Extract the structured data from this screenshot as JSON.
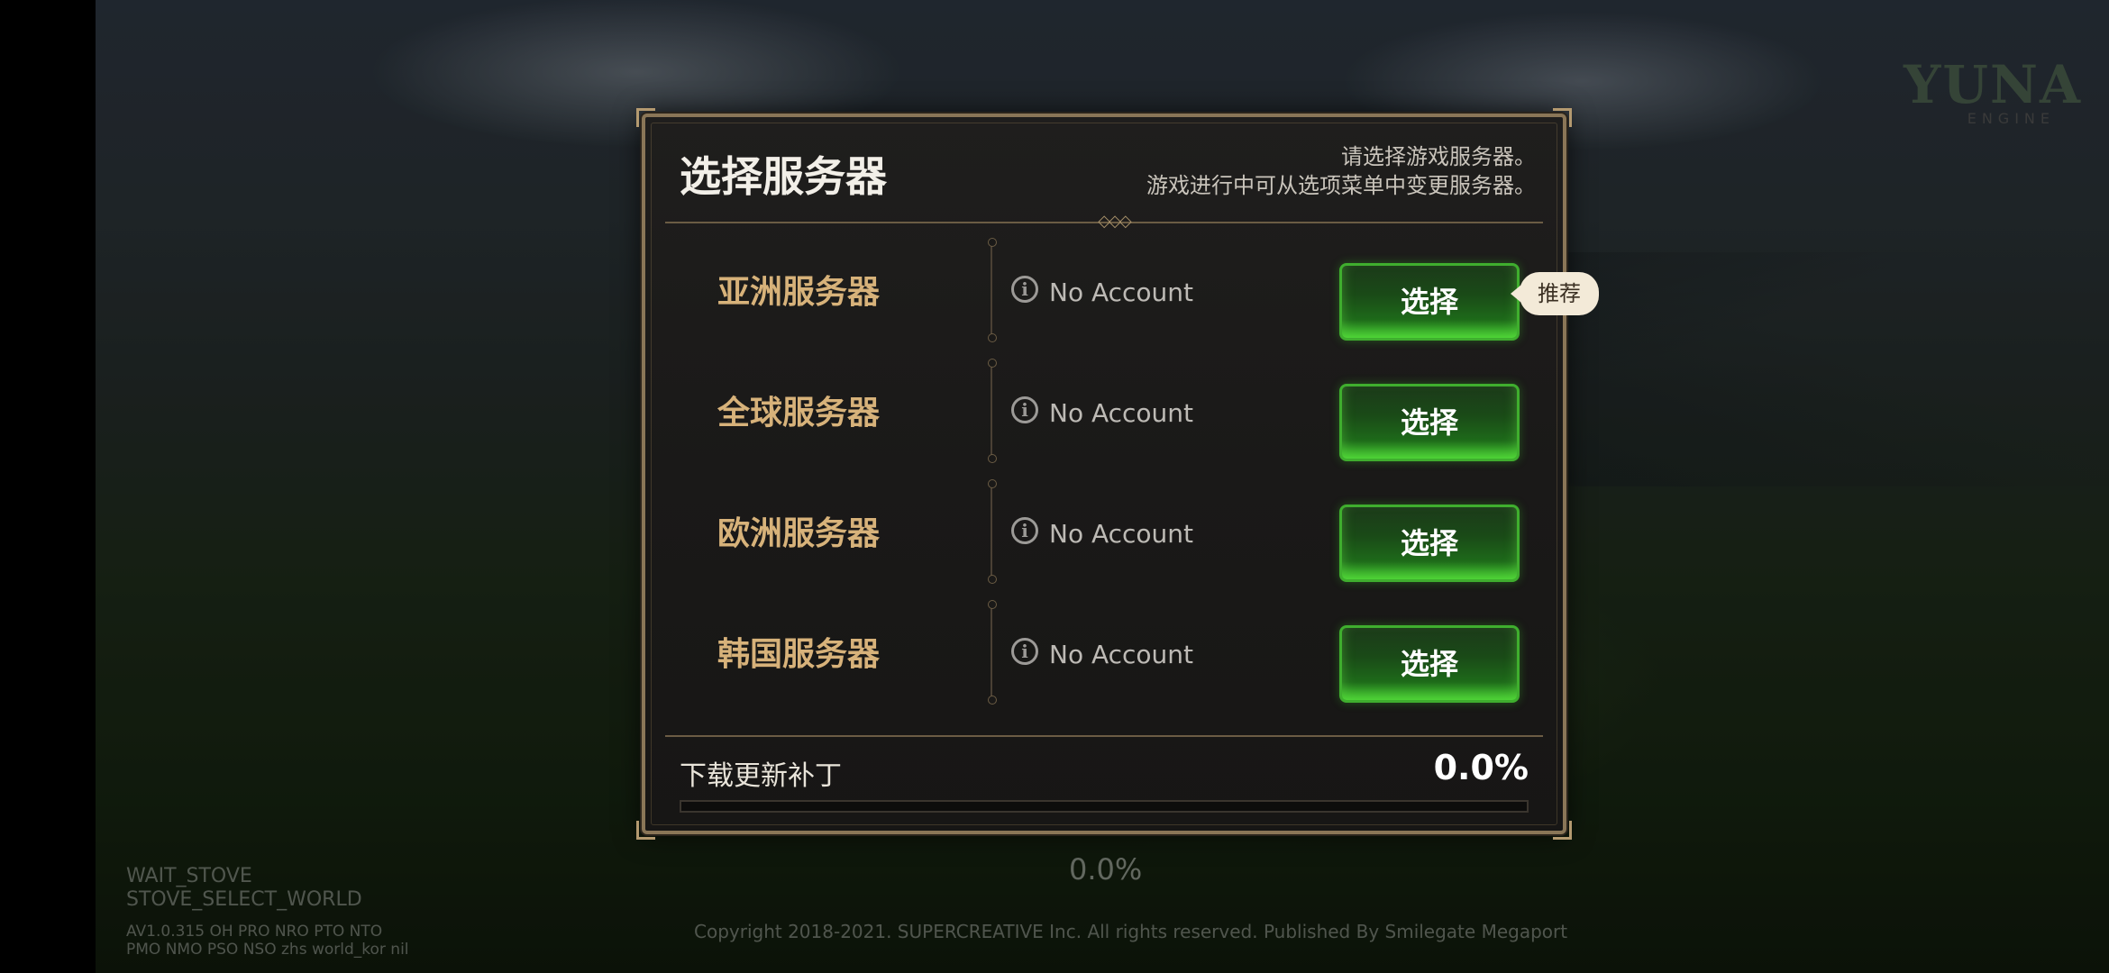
{
  "panel": {
    "title": "选择服务器",
    "hint_line1": "请选择游戏服务器。",
    "hint_line2": "游戏进行中可从选项菜单中变更服务器。"
  },
  "servers": [
    {
      "name": "亚洲服务器",
      "account": "No Account",
      "button": "选择"
    },
    {
      "name": "全球服务器",
      "account": "No Account",
      "button": "选择"
    },
    {
      "name": "欧洲服务器",
      "account": "No Account",
      "button": "选择"
    },
    {
      "name": "韩国服务器",
      "account": "No Account",
      "button": "选择"
    }
  ],
  "recommend_tag": "推荐",
  "download": {
    "label": "下载更新补丁",
    "percent": "0.0%",
    "progress": 0.0
  },
  "background_percent": "0.0%",
  "copyright": "Copyright 2018-2021. SUPERCREATIVE Inc. All rights reserved. Published By Smilegate Megaport",
  "debug": {
    "line1": "WAIT_STOVE",
    "line2": "STOVE_SELECT_WORLD",
    "line3": "AV1.0.315 OH PRO NRO PTO NTO",
    "line4": "PMO NMO PSO NSO zhs world_kor nil"
  },
  "logo": {
    "text": "YUNA",
    "sub": "ENGINE"
  },
  "colors": {
    "accent_green": "#3cc02c",
    "server_name": "#d7b27a",
    "frame_gold": "#8a7657"
  }
}
